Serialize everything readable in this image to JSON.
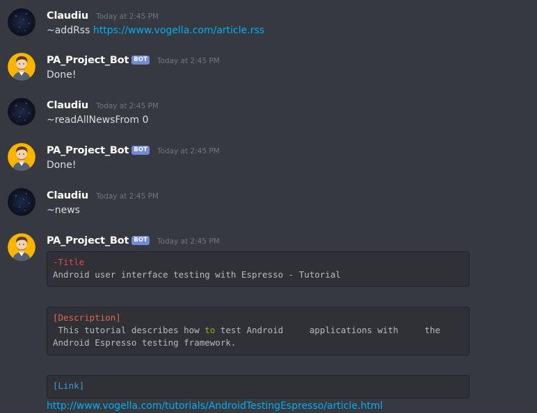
{
  "messages": [
    {
      "author": "Claudiu",
      "timestamp": "Today at 2:45 PM",
      "command": "~addRss",
      "link": "https://www.vogella.com/article.rss"
    },
    {
      "author": "PA_Project_Bot",
      "bot_tag": "BOT",
      "timestamp": "Today at 2:45 PM",
      "text": "Done!"
    },
    {
      "author": "Claudiu",
      "timestamp": "Today at 2:45 PM",
      "text": "~readAllNewsFrom 0"
    },
    {
      "author": "PA_Project_Bot",
      "bot_tag": "BOT",
      "timestamp": "Today at 2:45 PM",
      "text": "Done!"
    },
    {
      "author": "Claudiu",
      "timestamp": "Today at 2:45 PM",
      "text": "~news"
    },
    {
      "author": "PA_Project_Bot",
      "bot_tag": "BOT",
      "timestamp": "Today at 2:45 PM"
    }
  ],
  "embed": {
    "title_label": "-Title",
    "title_value": "Android user interface testing with Espresso - Tutorial",
    "description_label": "[Description]",
    "description_part1": " This tutorial describes how ",
    "description_keyword": "to",
    "description_part2": " test Android     applications with     the",
    "description_line2": "Android Espresso testing framework.",
    "link_label": "[Link]",
    "link_url": "http://www.vogella.com/tutorials/AndroidTestingEspresso/article.html"
  },
  "colors": {
    "background": "#36393f",
    "link": "#00b0f4",
    "bot_tag": "#7289da",
    "code_background": "#2f3136"
  },
  "icons": {
    "user_avatar": "starry-night-avatar",
    "bot_avatar": "cartoon-man-avatar"
  }
}
